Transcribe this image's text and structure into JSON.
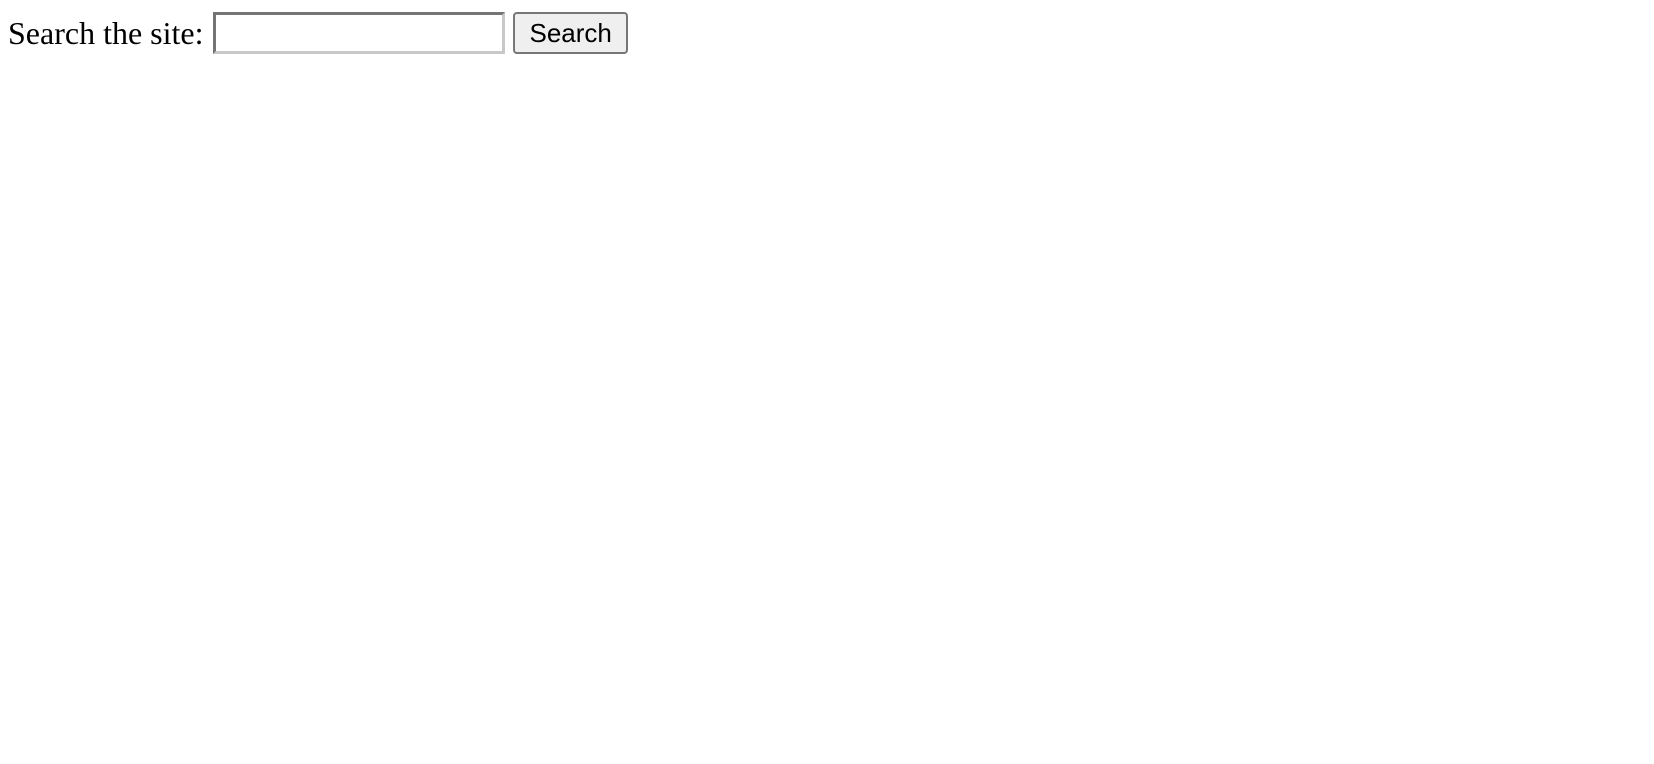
{
  "search": {
    "label": "Search the site:",
    "value": "",
    "placeholder": "",
    "button_label": "Search"
  }
}
